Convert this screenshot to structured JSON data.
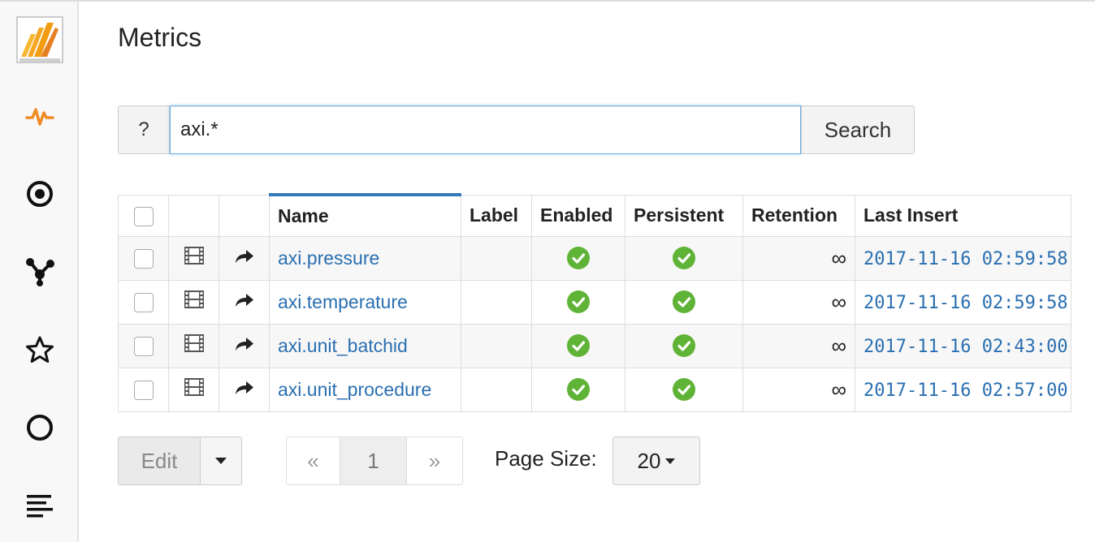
{
  "page": {
    "title": "Metrics"
  },
  "sidebar": {
    "items": [
      {
        "icon": "logo-icon"
      },
      {
        "icon": "activity-icon",
        "active": true,
        "color": "#f08a24"
      },
      {
        "icon": "target-icon"
      },
      {
        "icon": "network-icon"
      },
      {
        "icon": "star-icon"
      },
      {
        "icon": "circle-icon"
      },
      {
        "icon": "align-left-icon"
      }
    ]
  },
  "search": {
    "help_label": "?",
    "value": "axi.*",
    "button_label": "Search"
  },
  "table": {
    "columns": [
      "Name",
      "Label",
      "Enabled",
      "Persistent",
      "Retention",
      "Last Insert"
    ],
    "sorted_column": "Name",
    "rows": [
      {
        "name": "axi.pressure",
        "label": "",
        "enabled": true,
        "persistent": true,
        "retention": "∞",
        "last_insert": "2017-11-16 02:59:58"
      },
      {
        "name": "axi.temperature",
        "label": "",
        "enabled": true,
        "persistent": true,
        "retention": "∞",
        "last_insert": "2017-11-16 02:59:58"
      },
      {
        "name": "axi.unit_batchid",
        "label": "",
        "enabled": true,
        "persistent": true,
        "retention": "∞",
        "last_insert": "2017-11-16 02:43:00"
      },
      {
        "name": "axi.unit_procedure",
        "label": "",
        "enabled": true,
        "persistent": true,
        "retention": "∞",
        "last_insert": "2017-11-16 02:57:00"
      }
    ]
  },
  "actions": {
    "edit_label": "Edit"
  },
  "pagination": {
    "prev": "«",
    "current": "1",
    "next": "»"
  },
  "page_size": {
    "label": "Page Size:",
    "value": "20"
  },
  "colors": {
    "accent": "#337ab7",
    "link": "#2a6fb0",
    "success": "#5fb336",
    "brand": "#f7a823"
  }
}
